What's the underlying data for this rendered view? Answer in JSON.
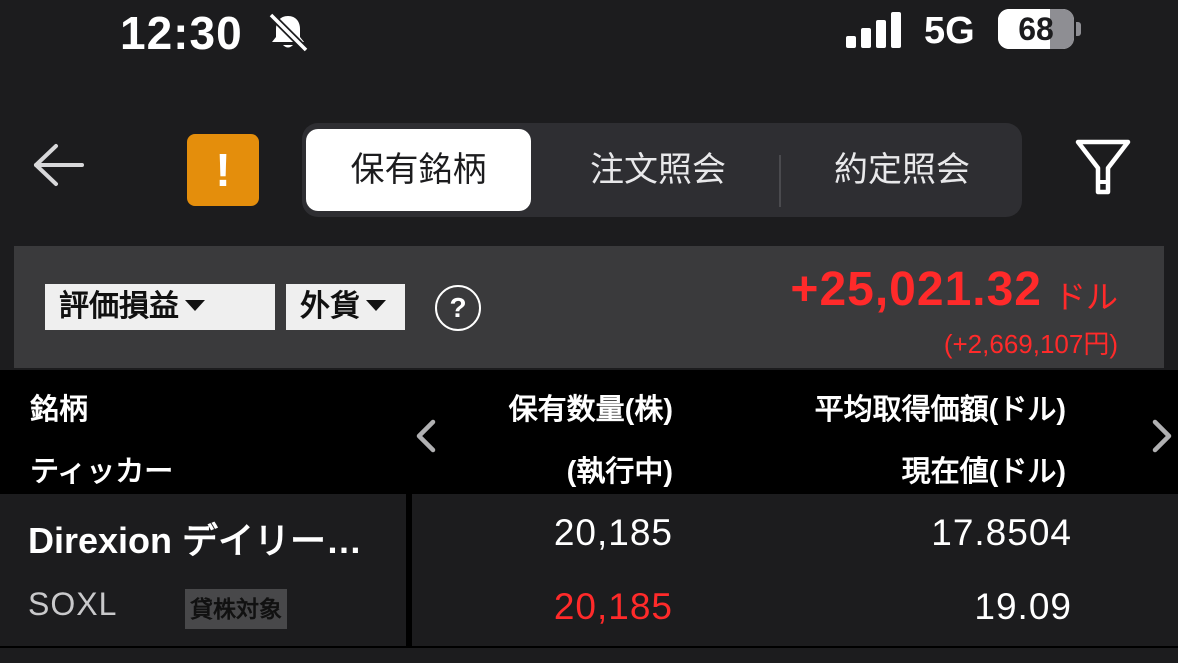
{
  "status_bar": {
    "time": "12:30",
    "network": "5G",
    "battery": "68",
    "battery_level": 0.68
  },
  "header": {
    "alert_label": "!",
    "tabs": [
      {
        "label": "保有銘柄",
        "active": true
      },
      {
        "label": "注文照会",
        "active": false
      },
      {
        "label": "約定照会",
        "active": false
      }
    ]
  },
  "summary": {
    "pl_type": "評価損益",
    "currency": "外貨",
    "help": "?",
    "pl_value": "+25,021.32",
    "pl_unit": "ドル",
    "pl_yen": "(+2,669,107円)"
  },
  "table": {
    "headers": {
      "name": "銘柄",
      "ticker": "ティッカー",
      "quantity": "保有数量(株)",
      "executing": "(執行中)",
      "avg_price": "平均取得価額(ドル)",
      "current_price": "現在値(ドル)"
    },
    "rows": [
      {
        "name": "Direxion デイリー…",
        "ticker": "SOXL",
        "badge": "貸株対象",
        "quantity": "20,185",
        "executing": "20,185",
        "avg_price": "17.8504",
        "current_price": "19.09"
      }
    ]
  },
  "colors": {
    "accent_alert": "#e48e0c",
    "profit_red": "#ff2a2a",
    "background": "#1c1c1e"
  },
  "icons": [
    "back-arrow-icon",
    "alert-icon",
    "filter-icon",
    "help-icon",
    "chevron-left-icon",
    "chevron-right-icon",
    "bell-slash-icon",
    "signal-icon",
    "battery-icon"
  ]
}
